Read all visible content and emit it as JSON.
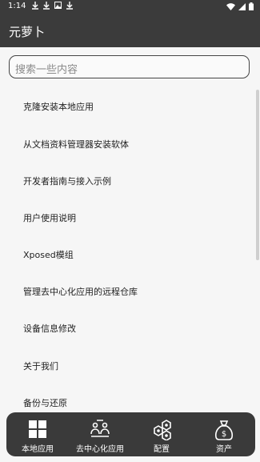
{
  "status_bar": {
    "time": "1:14",
    "icons": [
      "download-icon",
      "download-icon",
      "image-icon",
      "download-icon"
    ],
    "right_icons": [
      "wifi-icon",
      "signal-icon",
      "battery-icon"
    ]
  },
  "app_bar": {
    "title": "元萝卜"
  },
  "search": {
    "placeholder": "搜索一些内容"
  },
  "menu_items": [
    "克隆安装本地应用",
    "从文档资料管理器安装软体",
    "开发者指南与接入示例",
    "用户使用说明",
    "Xposed模组",
    "管理去中心化应用的远程仓库",
    "设备信息修改",
    "关于我们",
    "备份与还原"
  ],
  "bottom_nav": [
    {
      "label": "本地应用",
      "icon": "grid-icon"
    },
    {
      "label": "去中心化应用",
      "icon": "decentralized-apps-icon"
    },
    {
      "label": "配置",
      "icon": "hexagon-settings-icon"
    },
    {
      "label": "资产",
      "icon": "money-bag-icon"
    }
  ],
  "colors": {
    "bar_background": "#3b3b3b",
    "page_background": "#f6f6f6",
    "text": "#222222"
  }
}
